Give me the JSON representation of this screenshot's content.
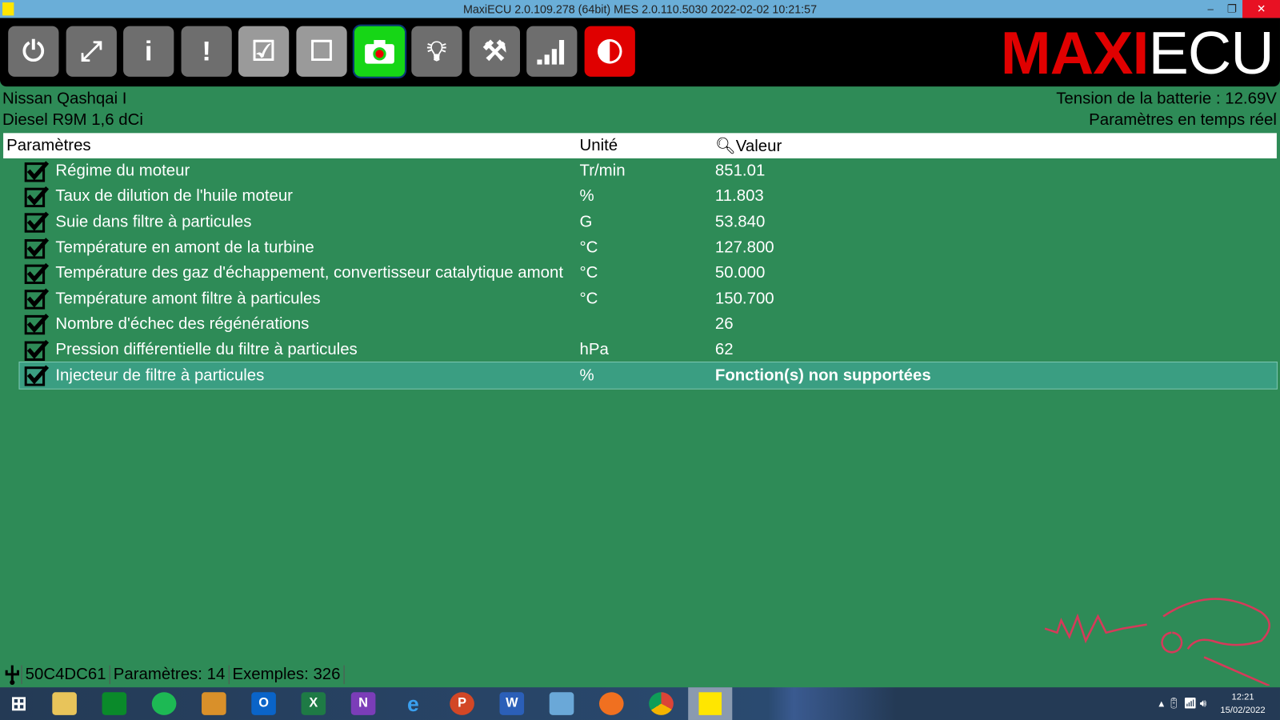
{
  "window": {
    "title": "MaxiECU 2.0.109.278 (64bit) MES 2.0.110.5030 2022-02-02 10:21:57"
  },
  "toolbar": {
    "buttons": [
      "power-icon",
      "fullscreen-icon",
      "info-icon",
      "alert-icon",
      "check-all-icon",
      "uncheck-all-icon",
      "record-icon",
      "bulb-icon",
      "tools-icon",
      "signal-icon",
      "contrast-icon"
    ],
    "logo_a": "MAXI",
    "logo_b": "ECU"
  },
  "vehicle": {
    "model": "Nissan Qashqai I",
    "engine": "Diesel R9M 1,6 dCi"
  },
  "battery": "Tension de la batterie : 12.69V",
  "mode": "Paramètres en temps réel",
  "table": {
    "headers": [
      "Paramètres",
      "Unité",
      "Valeur"
    ],
    "rows": [
      {
        "name": "Régime du moteur",
        "unit": "Tr/min",
        "value": "851.01"
      },
      {
        "name": "Taux de dilution de l'huile moteur",
        "unit": "%",
        "value": "11.803"
      },
      {
        "name": "Suie dans filtre à particules",
        "unit": "G",
        "value": "53.840"
      },
      {
        "name": "Température en amont de la turbine",
        "unit": "°C",
        "value": "127.800"
      },
      {
        "name": "Température des gaz d'échappement, convertisseur catalytique amont",
        "unit": "°C",
        "value": "50.000"
      },
      {
        "name": "Température amont filtre à particules",
        "unit": "°C",
        "value": "150.700"
      },
      {
        "name": "Nombre d'échec des régénérations",
        "unit": "",
        "value": "26"
      },
      {
        "name": "Pression différentielle du filtre à particules",
        "unit": "hPa",
        "value": "62"
      },
      {
        "name": "Injecteur de filtre à particules",
        "unit": "%",
        "value": "Fonction(s) non supportées"
      }
    ]
  },
  "status": {
    "device": "50C4DC61",
    "params": "Paramètres: 14",
    "samples": "Exemples: 326"
  },
  "taskbar": {
    "time": "12:21",
    "date": "15/02/2022"
  }
}
